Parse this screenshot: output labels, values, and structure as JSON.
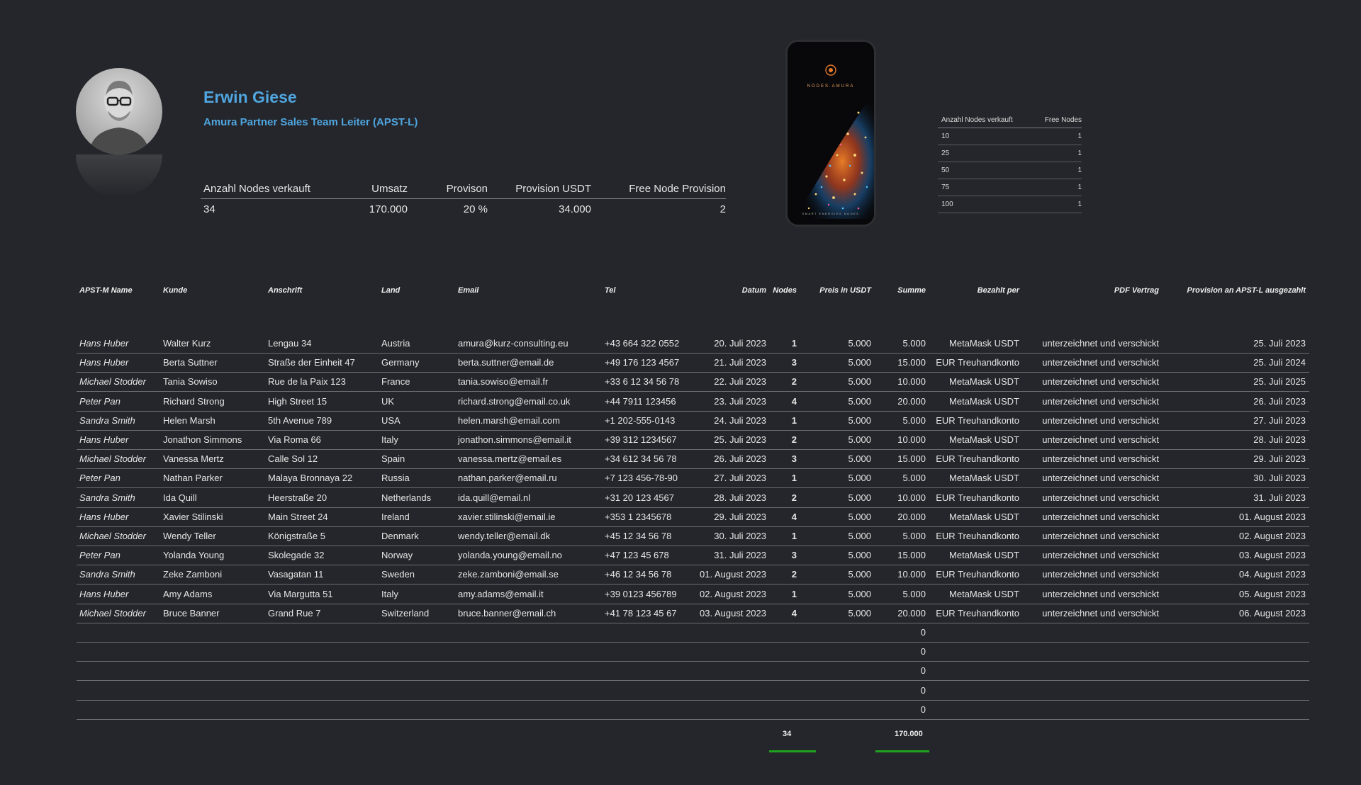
{
  "profile": {
    "name": "Erwin Giese",
    "role": "Amura Partner Sales Team Leiter (APST-L)"
  },
  "summary": {
    "headers": [
      "Anzahl Nodes verkauft",
      "Umsatz",
      "Provison",
      "Provision USDT",
      "Free Node Provision"
    ],
    "values": [
      "34",
      "170.000",
      "20 %",
      "34.000",
      "2"
    ]
  },
  "phone": {
    "brand": "NODES.AMURA",
    "tagline": "SMART ENERGIES NODES"
  },
  "free_table": {
    "headers": [
      "Anzahl Nodes verkauft",
      "Free Nodes"
    ],
    "rows": [
      [
        "10",
        "1"
      ],
      [
        "25",
        "1"
      ],
      [
        "50",
        "1"
      ],
      [
        "75",
        "1"
      ],
      [
        "100",
        "1"
      ]
    ]
  },
  "table": {
    "headers": [
      "APST-M Name",
      "Kunde",
      "Anschrift",
      "Land",
      "Email",
      "Tel",
      "Datum",
      "Nodes",
      "Preis in USDT",
      "Summe",
      "Bezahlt per",
      "PDF Vertrag",
      "Provision an APST-L ausgezahlt"
    ],
    "rows": [
      [
        "Hans Huber",
        "Walter Kurz",
        "Lengau 34",
        "Austria",
        "amura@kurz-consulting.eu",
        "+43 664 322 0552",
        "20. Juli 2023",
        "1",
        "5.000",
        "5.000",
        "MetaMask USDT",
        "unterzeichnet und verschickt",
        "25. Juli 2023"
      ],
      [
        "Hans Huber",
        "Berta Suttner",
        "Straße der Einheit 47",
        "Germany",
        "berta.suttner@email.de",
        "+49 176 123 4567",
        "21. Juli 2023",
        "3",
        "5.000",
        "15.000",
        "EUR Treuhandkonto",
        "unterzeichnet und verschickt",
        "25. Juli 2024"
      ],
      [
        "Michael Stodder",
        "Tania Sowiso",
        "Rue de la Paix 123",
        "France",
        "tania.sowiso@email.fr",
        "+33 6 12 34 56 78",
        "22. Juli 2023",
        "2",
        "5.000",
        "10.000",
        "MetaMask USDT",
        "unterzeichnet und verschickt",
        "25. Juli 2025"
      ],
      [
        "Peter Pan",
        "Richard Strong",
        "High Street 15",
        "UK",
        "richard.strong@email.co.uk",
        "+44 7911 123456",
        "23. Juli 2023",
        "4",
        "5.000",
        "20.000",
        "MetaMask USDT",
        "unterzeichnet und verschickt",
        "26. Juli 2023"
      ],
      [
        "Sandra Smith",
        "Helen Marsh",
        "5th Avenue 789",
        "USA",
        "helen.marsh@email.com",
        "+1 202-555-0143",
        "24. Juli 2023",
        "1",
        "5.000",
        "5.000",
        "EUR Treuhandkonto",
        "unterzeichnet und verschickt",
        "27. Juli 2023"
      ],
      [
        "Hans Huber",
        "Jonathon Simmons",
        "Via Roma 66",
        "Italy",
        "jonathon.simmons@email.it",
        "+39 312 1234567",
        "25. Juli 2023",
        "2",
        "5.000",
        "10.000",
        "MetaMask USDT",
        "unterzeichnet und verschickt",
        "28. Juli 2023"
      ],
      [
        "Michael Stodder",
        "Vanessa Mertz",
        "Calle Sol 12",
        "Spain",
        "vanessa.mertz@email.es",
        "+34 612 34 56 78",
        "26. Juli 2023",
        "3",
        "5.000",
        "15.000",
        "EUR Treuhandkonto",
        "unterzeichnet und verschickt",
        "29. Juli 2023"
      ],
      [
        "Peter Pan",
        "Nathan Parker",
        "Malaya Bronnaya 22",
        "Russia",
        "nathan.parker@email.ru",
        "+7 123 456-78-90",
        "27. Juli 2023",
        "1",
        "5.000",
        "5.000",
        "MetaMask USDT",
        "unterzeichnet und verschickt",
        "30. Juli 2023"
      ],
      [
        "Sandra Smith",
        "Ida Quill",
        "Heerstraße 20",
        "Netherlands",
        "ida.quill@email.nl",
        "+31 20 123 4567",
        "28. Juli 2023",
        "2",
        "5.000",
        "10.000",
        "EUR Treuhandkonto",
        "unterzeichnet und verschickt",
        "31. Juli 2023"
      ],
      [
        "Hans Huber",
        "Xavier Stilinski",
        "Main Street 24",
        "Ireland",
        "xavier.stilinski@email.ie",
        "+353 1 2345678",
        "29. Juli 2023",
        "4",
        "5.000",
        "20.000",
        "MetaMask USDT",
        "unterzeichnet und verschickt",
        "01. August 2023"
      ],
      [
        "Michael Stodder",
        "Wendy Teller",
        "Königstraße 5",
        "Denmark",
        "wendy.teller@email.dk",
        "+45 12 34 56 78",
        "30. Juli 2023",
        "1",
        "5.000",
        "5.000",
        "EUR Treuhandkonto",
        "unterzeichnet und verschickt",
        "02. August 2023"
      ],
      [
        "Peter Pan",
        "Yolanda Young",
        "Skolegade 32",
        "Norway",
        "yolanda.young@email.no",
        "+47 123 45 678",
        "31. Juli 2023",
        "3",
        "5.000",
        "15.000",
        "MetaMask USDT",
        "unterzeichnet und verschickt",
        "03. August 2023"
      ],
      [
        "Sandra Smith",
        "Zeke Zamboni",
        "Vasagatan 11",
        "Sweden",
        "zeke.zamboni@email.se",
        "+46 12 34 56 78",
        "01. August 2023",
        "2",
        "5.000",
        "10.000",
        "EUR Treuhandkonto",
        "unterzeichnet und verschickt",
        "04. August 2023"
      ],
      [
        "Hans Huber",
        "Amy Adams",
        "Via Margutta 51",
        "Italy",
        "amy.adams@email.it",
        "+39 0123 456789",
        "02. August 2023",
        "1",
        "5.000",
        "5.000",
        "MetaMask USDT",
        "unterzeichnet und verschickt",
        "05. August 2023"
      ],
      [
        "Michael Stodder",
        "Bruce Banner",
        "Grand Rue 7",
        "Switzerland",
        "bruce.banner@email.ch",
        "+41 78 123 45 67",
        "03. August 2023",
        "4",
        "5.000",
        "20.000",
        "EUR Treuhandkonto",
        "unterzeichnet und verschickt",
        "06. August 2023"
      ]
    ],
    "empty_rows": [
      "0",
      "0",
      "0",
      "0",
      "0"
    ],
    "totals": {
      "nodes": "34",
      "summe": "170.000"
    }
  },
  "colors": {
    "background": "#25262b",
    "accent_blue": "#4fa6e0",
    "total_underline": "#1fa31f"
  }
}
